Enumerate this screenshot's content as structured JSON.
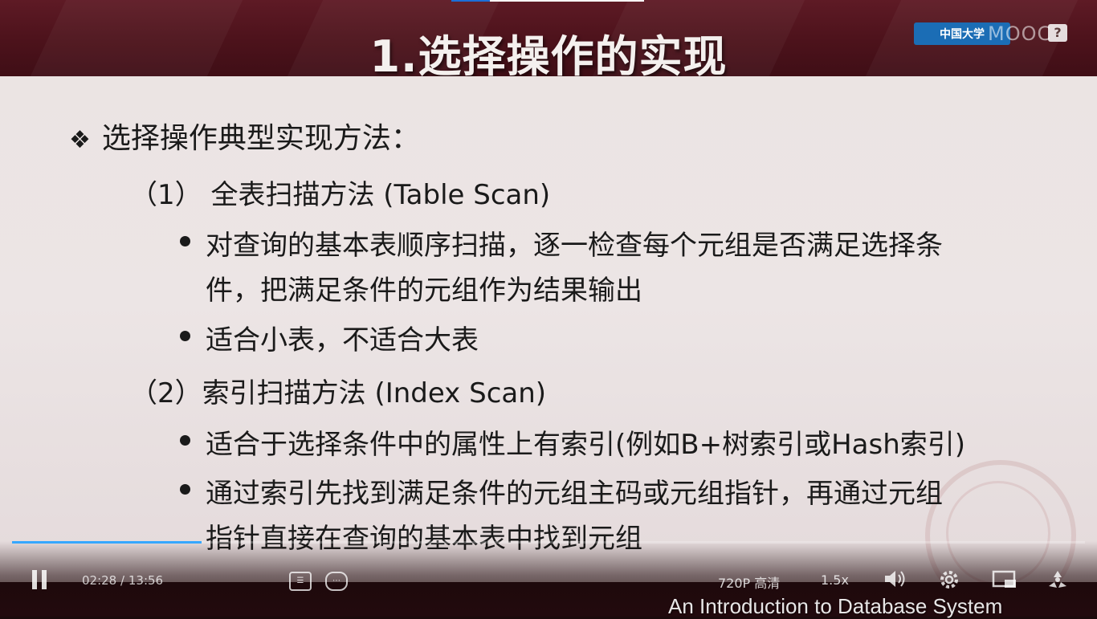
{
  "slide": {
    "title": "1.选择操作的实现",
    "heading": "选择操作典型实现方法：",
    "method1": {
      "label": "（1） 全表扫描方法 (Table Scan)",
      "bullets": [
        {
          "line1": "对查询的基本表顺序扫描，逐一检查每个元组是否满足选择条",
          "line2": "件，把满足条件的元组作为结果输出"
        },
        {
          "line1": "适合小表，不适合大表",
          "line2": ""
        }
      ]
    },
    "method2": {
      "label": "（2）索引扫描方法 (Index Scan)",
      "bullets": [
        {
          "line1": "适合于选择条件中的属性上有索引(例如B+树索引或Hash索引)",
          "line2": ""
        },
        {
          "line1": "通过索引先找到满足条件的元组主码或元组指针，再通过元组",
          "line2": "指针直接在查询的基本表中找到元组"
        }
      ]
    },
    "course_name": "An Introduction to Database System"
  },
  "overlay": {
    "logo_badge": "中国大学",
    "logo_text": "MOOC",
    "help": "?"
  },
  "player": {
    "current_time": "02:28",
    "separator": "/",
    "total_time": "13:56",
    "progress_fraction": 0.177,
    "quality": "720P 高清",
    "speed": "1.5x",
    "colors": {
      "progress": "#36a7ff",
      "title_bar": "#4c121b"
    },
    "icons": [
      "pause-icon",
      "subtitle-icon",
      "danmaku-icon",
      "volume-icon",
      "settings-icon",
      "picture-in-picture-icon",
      "fullscreen-icon"
    ]
  }
}
